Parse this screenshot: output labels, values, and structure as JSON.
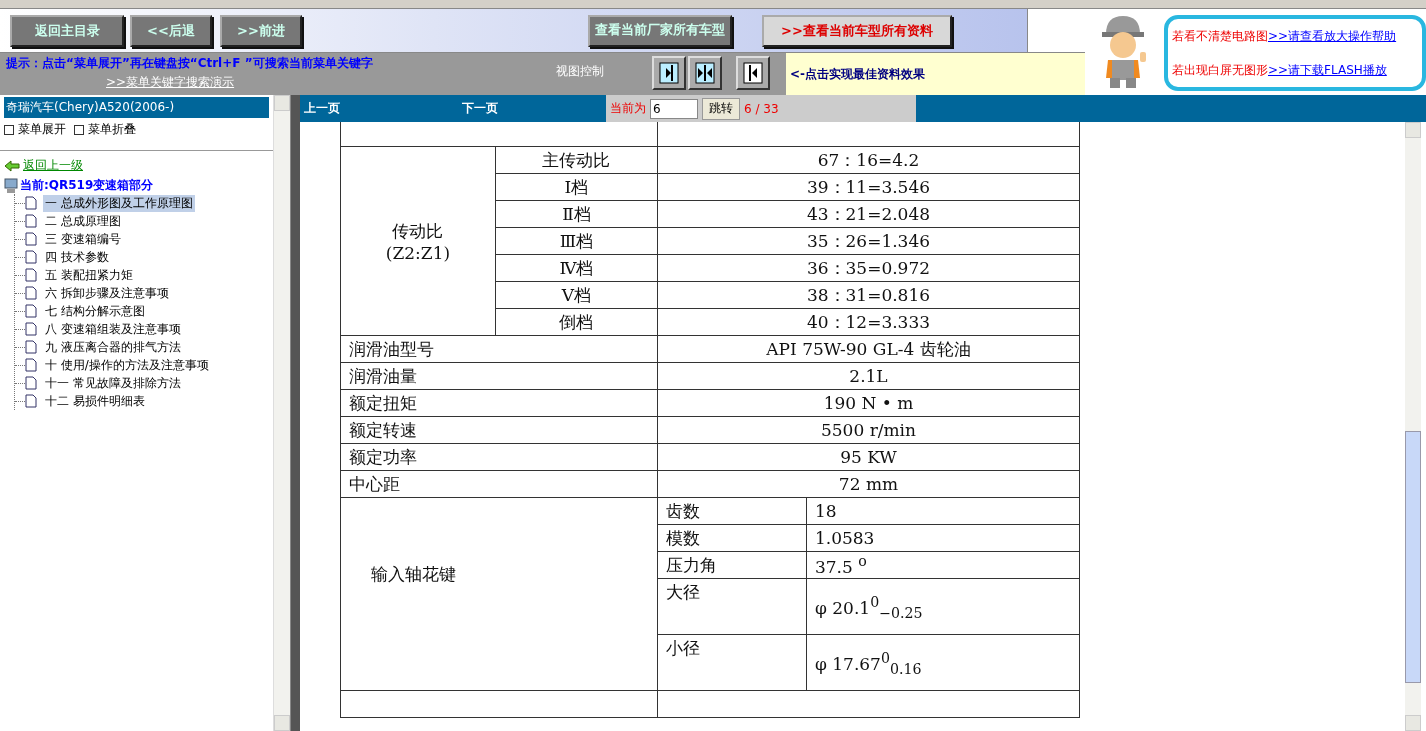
{
  "toolbar": {
    "buttons": [
      "返回主目录",
      "<<后退",
      ">>前进"
    ],
    "maker_button": "查看当前厂家所有车型",
    "model_button": ">>查看当前车型所有资料"
  },
  "hint": {
    "text": "提示：点击“菜单展开”再在键盘按“Ctrl+F ”可搜索当前菜单关键字",
    "link": ">>菜单关键字搜索演示"
  },
  "view_control": {
    "label": "视图控制",
    "note": "<-点击实现最佳资料效果"
  },
  "help": [
    {
      "text": "若看不清楚电路图",
      "link": ">>请查看放大操作帮助"
    },
    {
      "text": "若出现白屏无图形",
      "link": ">>请下载FLASH播放"
    }
  ],
  "sidebar": {
    "title": "奇瑞汽车(Chery)A520(2006-)",
    "expand": "菜单展开",
    "collapse": "菜单折叠",
    "back": "返回上一级",
    "current": "当前:QR519变速箱部分",
    "items": [
      {
        "label": "一  总成外形图及工作原理图",
        "selected": true
      },
      {
        "label": "二  总成原理图",
        "selected": false
      },
      {
        "label": "三  变速箱编号",
        "selected": false
      },
      {
        "label": "四  技术参数",
        "selected": false
      },
      {
        "label": "五  装配扭紧力矩",
        "selected": false
      },
      {
        "label": "六  拆卸步骤及注意事项",
        "selected": false
      },
      {
        "label": "七  结构分解示意图",
        "selected": false
      },
      {
        "label": "八  变速箱组装及注意事项",
        "selected": false
      },
      {
        "label": "九  液压离合器的排气方法",
        "selected": false
      },
      {
        "label": "十  使用/操作的方法及注意事项",
        "selected": false
      },
      {
        "label": "十一  常见故障及排除方法",
        "selected": false
      },
      {
        "label": "十二  易损件明细表",
        "selected": false
      }
    ]
  },
  "pager": {
    "prev": "上一页",
    "next": "下一页",
    "current_label": "当前为",
    "page_value": "6",
    "go_button": "跳转",
    "page_count": "6 / 33"
  },
  "document": {
    "ratio_group": [
      "传动比",
      "(Z2:Z1)"
    ],
    "ratio_rows": [
      {
        "label": "主传动比",
        "value": "67：16=4.2"
      },
      {
        "label": "Ⅰ档",
        "value": "39：11=3.546"
      },
      {
        "label": "Ⅱ档",
        "value": "43：21=2.048"
      },
      {
        "label": "Ⅲ档",
        "value": "35：26=1.346"
      },
      {
        "label": "Ⅳ档",
        "value": "36：35=0.972"
      },
      {
        "label": "Ⅴ档",
        "value": "38：31=0.816"
      },
      {
        "label": "倒档",
        "value": "40：12=3.333"
      }
    ],
    "spec_rows": [
      {
        "label": "润滑油型号",
        "value": "API    75W-90 GL-4    齿轮油"
      },
      {
        "label": "润滑油量",
        "value": "2.1L"
      },
      {
        "label": "额定扭矩",
        "value": "190 N • m"
      },
      {
        "label": "额定转速",
        "value": "5500 r/min"
      },
      {
        "label": "额定功率",
        "value": "95 KW"
      },
      {
        "label": "中心距",
        "value": "72 mm"
      }
    ],
    "spline_group": "输入轴花键",
    "spline_rows": [
      {
        "label": "齿数",
        "value": "18",
        "kind": "short"
      },
      {
        "label": "模数",
        "value": "1.0583",
        "kind": "short"
      },
      {
        "label": "压力角",
        "value": "37.5 $^{o}$",
        "kind": "short"
      },
      {
        "label": "大径",
        "value": "φ 20.1$^{0}$$_{−0.25}$",
        "kind": "tall"
      },
      {
        "label": "小径",
        "value": "φ 17.67$^{0}$$_{0.16}$",
        "kind": "tall"
      }
    ]
  }
}
